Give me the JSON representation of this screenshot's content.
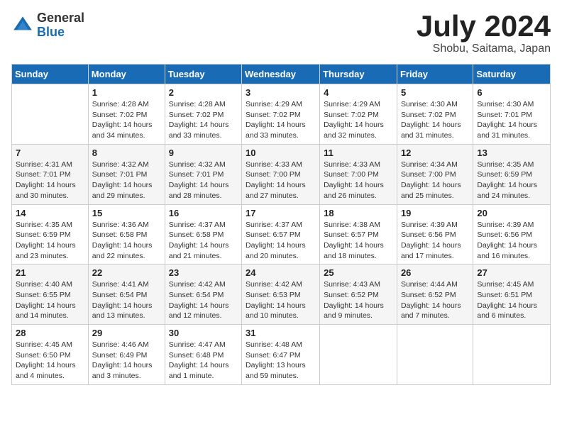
{
  "logo": {
    "general": "General",
    "blue": "Blue"
  },
  "title": "July 2024",
  "location": "Shobu, Saitama, Japan",
  "days_of_week": [
    "Sunday",
    "Monday",
    "Tuesday",
    "Wednesday",
    "Thursday",
    "Friday",
    "Saturday"
  ],
  "weeks": [
    [
      {
        "day": "",
        "info": ""
      },
      {
        "day": "1",
        "info": "Sunrise: 4:28 AM\nSunset: 7:02 PM\nDaylight: 14 hours\nand 34 minutes."
      },
      {
        "day": "2",
        "info": "Sunrise: 4:28 AM\nSunset: 7:02 PM\nDaylight: 14 hours\nand 33 minutes."
      },
      {
        "day": "3",
        "info": "Sunrise: 4:29 AM\nSunset: 7:02 PM\nDaylight: 14 hours\nand 33 minutes."
      },
      {
        "day": "4",
        "info": "Sunrise: 4:29 AM\nSunset: 7:02 PM\nDaylight: 14 hours\nand 32 minutes."
      },
      {
        "day": "5",
        "info": "Sunrise: 4:30 AM\nSunset: 7:02 PM\nDaylight: 14 hours\nand 31 minutes."
      },
      {
        "day": "6",
        "info": "Sunrise: 4:30 AM\nSunset: 7:01 PM\nDaylight: 14 hours\nand 31 minutes."
      }
    ],
    [
      {
        "day": "7",
        "info": "Sunrise: 4:31 AM\nSunset: 7:01 PM\nDaylight: 14 hours\nand 30 minutes."
      },
      {
        "day": "8",
        "info": "Sunrise: 4:32 AM\nSunset: 7:01 PM\nDaylight: 14 hours\nand 29 minutes."
      },
      {
        "day": "9",
        "info": "Sunrise: 4:32 AM\nSunset: 7:01 PM\nDaylight: 14 hours\nand 28 minutes."
      },
      {
        "day": "10",
        "info": "Sunrise: 4:33 AM\nSunset: 7:00 PM\nDaylight: 14 hours\nand 27 minutes."
      },
      {
        "day": "11",
        "info": "Sunrise: 4:33 AM\nSunset: 7:00 PM\nDaylight: 14 hours\nand 26 minutes."
      },
      {
        "day": "12",
        "info": "Sunrise: 4:34 AM\nSunset: 7:00 PM\nDaylight: 14 hours\nand 25 minutes."
      },
      {
        "day": "13",
        "info": "Sunrise: 4:35 AM\nSunset: 6:59 PM\nDaylight: 14 hours\nand 24 minutes."
      }
    ],
    [
      {
        "day": "14",
        "info": "Sunrise: 4:35 AM\nSunset: 6:59 PM\nDaylight: 14 hours\nand 23 minutes."
      },
      {
        "day": "15",
        "info": "Sunrise: 4:36 AM\nSunset: 6:58 PM\nDaylight: 14 hours\nand 22 minutes."
      },
      {
        "day": "16",
        "info": "Sunrise: 4:37 AM\nSunset: 6:58 PM\nDaylight: 14 hours\nand 21 minutes."
      },
      {
        "day": "17",
        "info": "Sunrise: 4:37 AM\nSunset: 6:57 PM\nDaylight: 14 hours\nand 20 minutes."
      },
      {
        "day": "18",
        "info": "Sunrise: 4:38 AM\nSunset: 6:57 PM\nDaylight: 14 hours\nand 18 minutes."
      },
      {
        "day": "19",
        "info": "Sunrise: 4:39 AM\nSunset: 6:56 PM\nDaylight: 14 hours\nand 17 minutes."
      },
      {
        "day": "20",
        "info": "Sunrise: 4:39 AM\nSunset: 6:56 PM\nDaylight: 14 hours\nand 16 minutes."
      }
    ],
    [
      {
        "day": "21",
        "info": "Sunrise: 4:40 AM\nSunset: 6:55 PM\nDaylight: 14 hours\nand 14 minutes."
      },
      {
        "day": "22",
        "info": "Sunrise: 4:41 AM\nSunset: 6:54 PM\nDaylight: 14 hours\nand 13 minutes."
      },
      {
        "day": "23",
        "info": "Sunrise: 4:42 AM\nSunset: 6:54 PM\nDaylight: 14 hours\nand 12 minutes."
      },
      {
        "day": "24",
        "info": "Sunrise: 4:42 AM\nSunset: 6:53 PM\nDaylight: 14 hours\nand 10 minutes."
      },
      {
        "day": "25",
        "info": "Sunrise: 4:43 AM\nSunset: 6:52 PM\nDaylight: 14 hours\nand 9 minutes."
      },
      {
        "day": "26",
        "info": "Sunrise: 4:44 AM\nSunset: 6:52 PM\nDaylight: 14 hours\nand 7 minutes."
      },
      {
        "day": "27",
        "info": "Sunrise: 4:45 AM\nSunset: 6:51 PM\nDaylight: 14 hours\nand 6 minutes."
      }
    ],
    [
      {
        "day": "28",
        "info": "Sunrise: 4:45 AM\nSunset: 6:50 PM\nDaylight: 14 hours\nand 4 minutes."
      },
      {
        "day": "29",
        "info": "Sunrise: 4:46 AM\nSunset: 6:49 PM\nDaylight: 14 hours\nand 3 minutes."
      },
      {
        "day": "30",
        "info": "Sunrise: 4:47 AM\nSunset: 6:48 PM\nDaylight: 14 hours\nand 1 minute."
      },
      {
        "day": "31",
        "info": "Sunrise: 4:48 AM\nSunset: 6:47 PM\nDaylight: 13 hours\nand 59 minutes."
      },
      {
        "day": "",
        "info": ""
      },
      {
        "day": "",
        "info": ""
      },
      {
        "day": "",
        "info": ""
      }
    ]
  ]
}
